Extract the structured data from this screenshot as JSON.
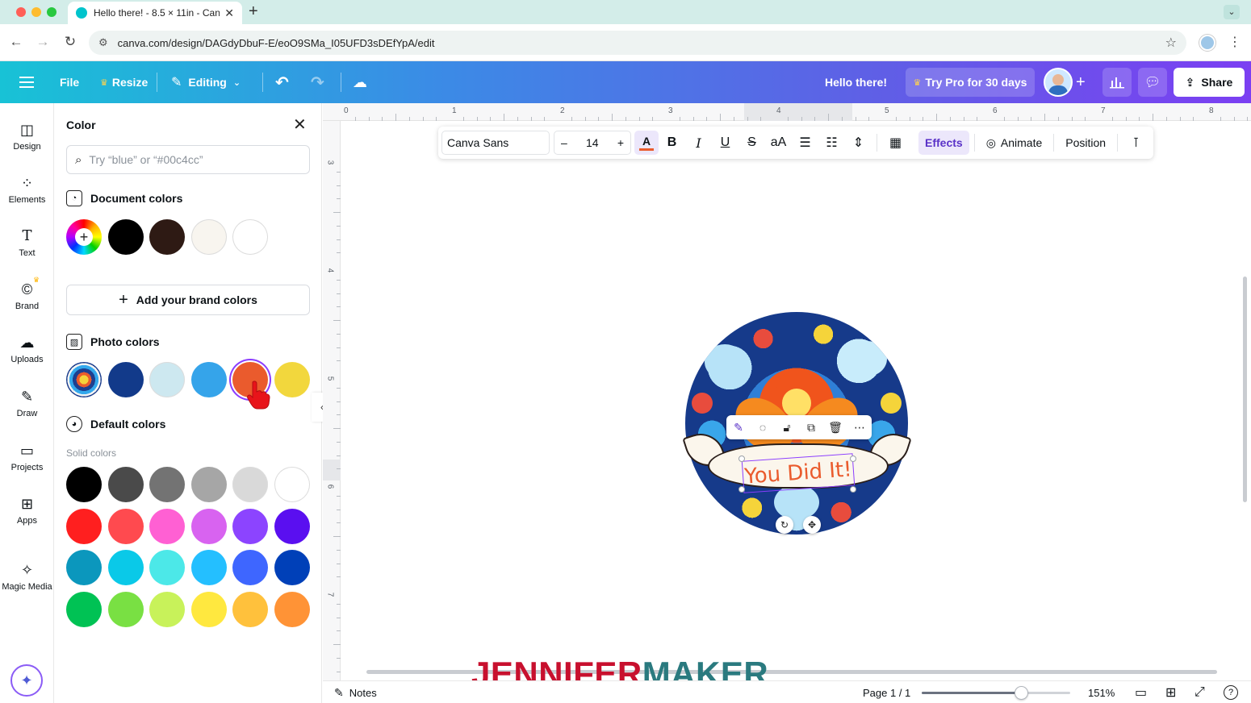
{
  "browser": {
    "tab_title": "Hello there! - 8.5 × 11in - Can",
    "url": "canva.com/design/DAGdyDbuF-E/eoO9SMa_I05UFD3sDEfYpA/edit"
  },
  "header": {
    "file": "File",
    "resize": "Resize",
    "editing": "Editing",
    "design_title": "Hello there!",
    "try_pro": "Try Pro for 30 days",
    "share": "Share"
  },
  "rail": {
    "items": [
      {
        "label": "Design",
        "icon": "design-icon"
      },
      {
        "label": "Elements",
        "icon": "elements-icon"
      },
      {
        "label": "Text",
        "icon": "text-icon"
      },
      {
        "label": "Brand",
        "icon": "brand-icon"
      },
      {
        "label": "Uploads",
        "icon": "uploads-icon"
      },
      {
        "label": "Draw",
        "icon": "draw-icon"
      },
      {
        "label": "Projects",
        "icon": "projects-icon"
      },
      {
        "label": "Apps",
        "icon": "apps-icon"
      },
      {
        "label": "Magic Media",
        "icon": "magic-media-icon"
      }
    ]
  },
  "color_panel": {
    "title": "Color",
    "search_placeholder": "Try “blue” or “#00c4cc”",
    "document_colors_heading": "Document colors",
    "document_colors": [
      "#000000",
      "#2e1a14",
      "#f8f5ef",
      "#ffffff"
    ],
    "add_brand_colors": "Add your brand colors",
    "photo_colors_heading": "Photo colors",
    "photo_colors": [
      "#123a8a",
      "#cde8f0",
      "#35a4ea",
      "#ea5b2d",
      "#f2d73d"
    ],
    "selected_photo_color": "#ea5b2d",
    "default_colors_heading": "Default colors",
    "solid_colors_label": "Solid colors",
    "solid_colors": [
      [
        "#000000",
        "#4a4a4a",
        "#737373",
        "#a6a6a6",
        "#d9d9d9",
        "#ffffff"
      ],
      [
        "#ff1f1f",
        "#ff4a4f",
        "#ff60d3",
        "#d863f0",
        "#8c44ff",
        "#5a0ff0"
      ],
      [
        "#0b97bd",
        "#0ac9e8",
        "#4ce8e8",
        "#24bfff",
        "#3e66ff",
        "#0040b8"
      ],
      [
        "#00c254",
        "#79e043",
        "#c8f25a",
        "#ffe83f",
        "#ffc13c",
        "#ff9336"
      ]
    ]
  },
  "text_toolbar": {
    "font": "Canva Sans",
    "size": "14",
    "minus": "–",
    "plus": "+",
    "bold": "B",
    "italic": "I",
    "underline": "U",
    "strike": "S",
    "case": "aA",
    "effects": "Effects",
    "animate": "Animate",
    "position": "Position",
    "text_color": "#ea5b2d"
  },
  "canvas": {
    "ruler_top": [
      "0",
      "1",
      "2",
      "3",
      "4",
      "5",
      "6",
      "7",
      "8"
    ],
    "ruler_left": [
      "3",
      "4",
      "5",
      "6",
      "7"
    ],
    "sticker_text": "You Did It!"
  },
  "watermark": {
    "part1": "JENNIFER",
    "part2": "MAKER"
  },
  "footer": {
    "notes": "Notes",
    "page": "Page 1 / 1",
    "zoom": "151%",
    "zoom_slider_fraction": 0.67
  }
}
